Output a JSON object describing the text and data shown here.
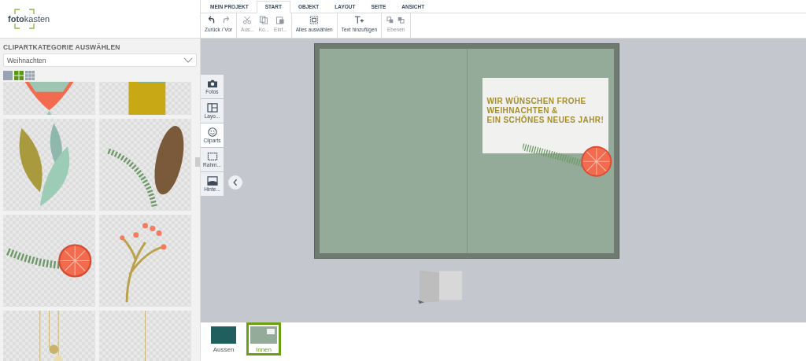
{
  "logo": {
    "text": "**foto**kasten"
  },
  "tabs": [
    {
      "label": "MEIN PROJEKT",
      "selected": false
    },
    {
      "label": "START",
      "selected": true
    },
    {
      "label": "OBJEKT",
      "selected": false
    },
    {
      "label": "LAYOUT",
      "selected": false
    },
    {
      "label": "SEITE",
      "selected": false
    },
    {
      "label": "ANSICHT",
      "selected": false
    }
  ],
  "toolbar": {
    "groups": [
      [
        {
          "kind": "undo-redo",
          "label": "Zurück / Vor",
          "disabled": false
        }
      ],
      [
        {
          "kind": "cut",
          "label": "Aus...",
          "disabled": true
        },
        {
          "kind": "copy",
          "label": "Ko...",
          "disabled": true
        },
        {
          "kind": "paste",
          "label": "Einf...",
          "disabled": true
        }
      ],
      [
        {
          "kind": "select-all",
          "label": "Alles auswählen",
          "disabled": false
        }
      ],
      [
        {
          "kind": "add-text",
          "label": "Text hinzufügen",
          "disabled": false
        }
      ],
      [
        {
          "kind": "layers",
          "label": "Ebenen",
          "disabled": true
        }
      ]
    ]
  },
  "sidebar": {
    "title": "CLIPARTKATEGORIE AUSWÄHLEN",
    "category": {
      "value": "Weihnachten"
    },
    "view_sizes": [
      {
        "kind": "large",
        "selected": false
      },
      {
        "kind": "medium",
        "selected": true
      },
      {
        "kind": "small",
        "selected": false
      }
    ]
  },
  "side_tabs": [
    {
      "kind": "photos",
      "label": "Fotos",
      "selected": false
    },
    {
      "kind": "layouts",
      "label": "Layo...",
      "selected": false
    },
    {
      "kind": "cliparts",
      "label": "Cliparts",
      "selected": true
    },
    {
      "kind": "frames",
      "label": "Rahm...",
      "selected": false
    },
    {
      "kind": "backgrounds",
      "label": "Hinte...",
      "selected": false
    }
  ],
  "card": {
    "greeting": [
      "WIR WÜNSCHEN FROHE",
      "WEIHNACHTEN &",
      "EIN SCHÖNES NEUES JAHR!"
    ]
  },
  "pages": [
    {
      "label": "Aussen",
      "kind": "outside",
      "selected": false
    },
    {
      "label": "Innen",
      "kind": "inside",
      "selected": true
    }
  ]
}
